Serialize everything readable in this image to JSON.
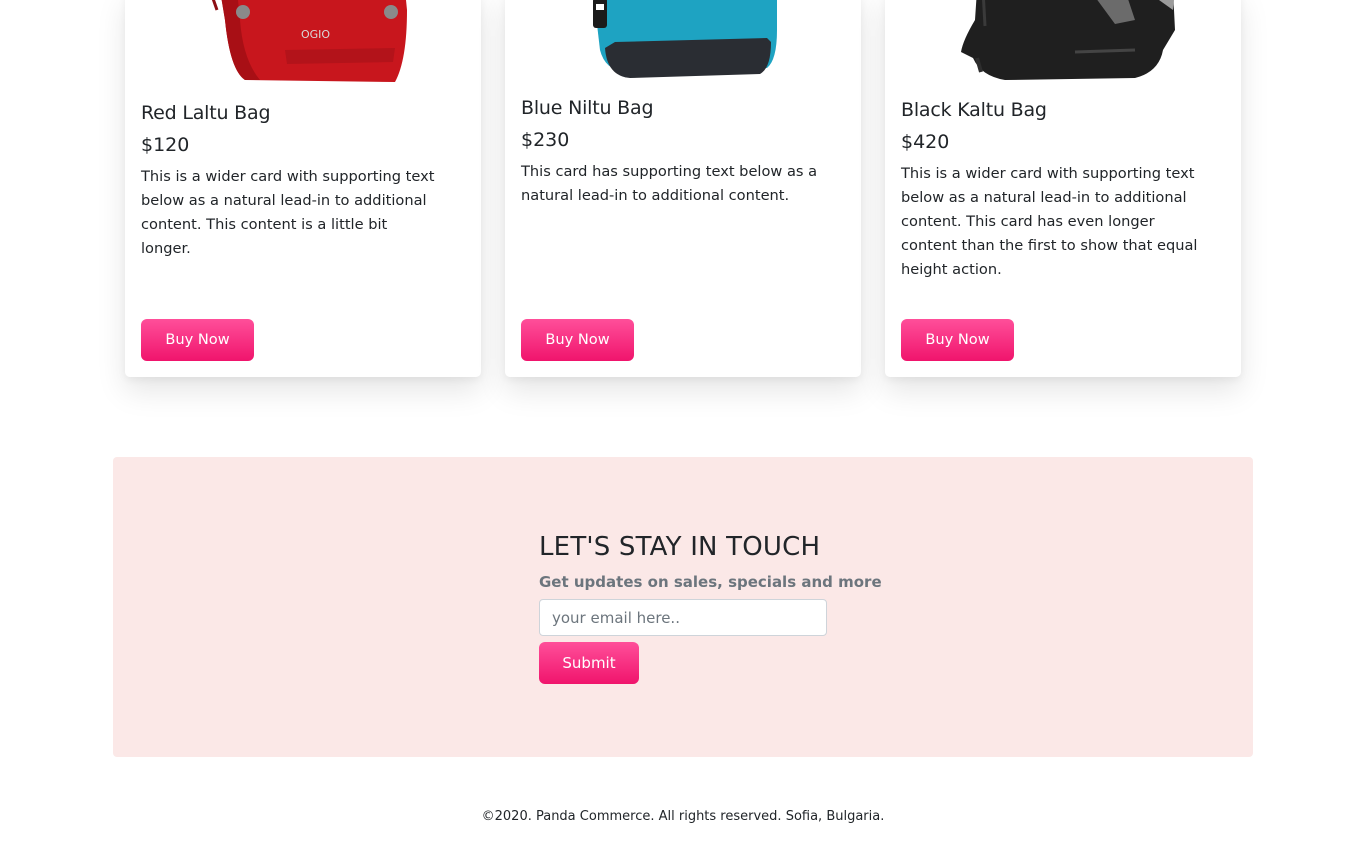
{
  "products": [
    {
      "title": "Red Laltu Bag",
      "price": "$120",
      "text": "This is a wider card with supporting text below as a natural lead-in to additional content. This content is a little bit longer.",
      "button": "Buy Now",
      "color": "#c8161d"
    },
    {
      "title": "Blue Niltu Bag",
      "price": "$230",
      "text": "This card has supporting text below as a natural lead-in to additional content.",
      "button": "Buy Now",
      "color": "#1ea3c2"
    },
    {
      "title": "Black Kaltu Bag",
      "price": "$420",
      "text": "This is a wider card with supporting text below as a natural lead-in to additional content. This card has even longer content than the first to show that equal height action.",
      "button": "Buy Now",
      "color": "#1f1f1f"
    }
  ],
  "newsletter": {
    "heading": "LET'S STAY IN TOUCH",
    "subheading": "Get updates on sales, specials and more",
    "email_placeholder": "your email here..",
    "submit_label": "Submit",
    "background": "#fbe8e7"
  },
  "footer": {
    "text": "©2020. Panda Commerce. All rights reserved. Sofia, Bulgaria."
  },
  "accent": "#f0146c"
}
